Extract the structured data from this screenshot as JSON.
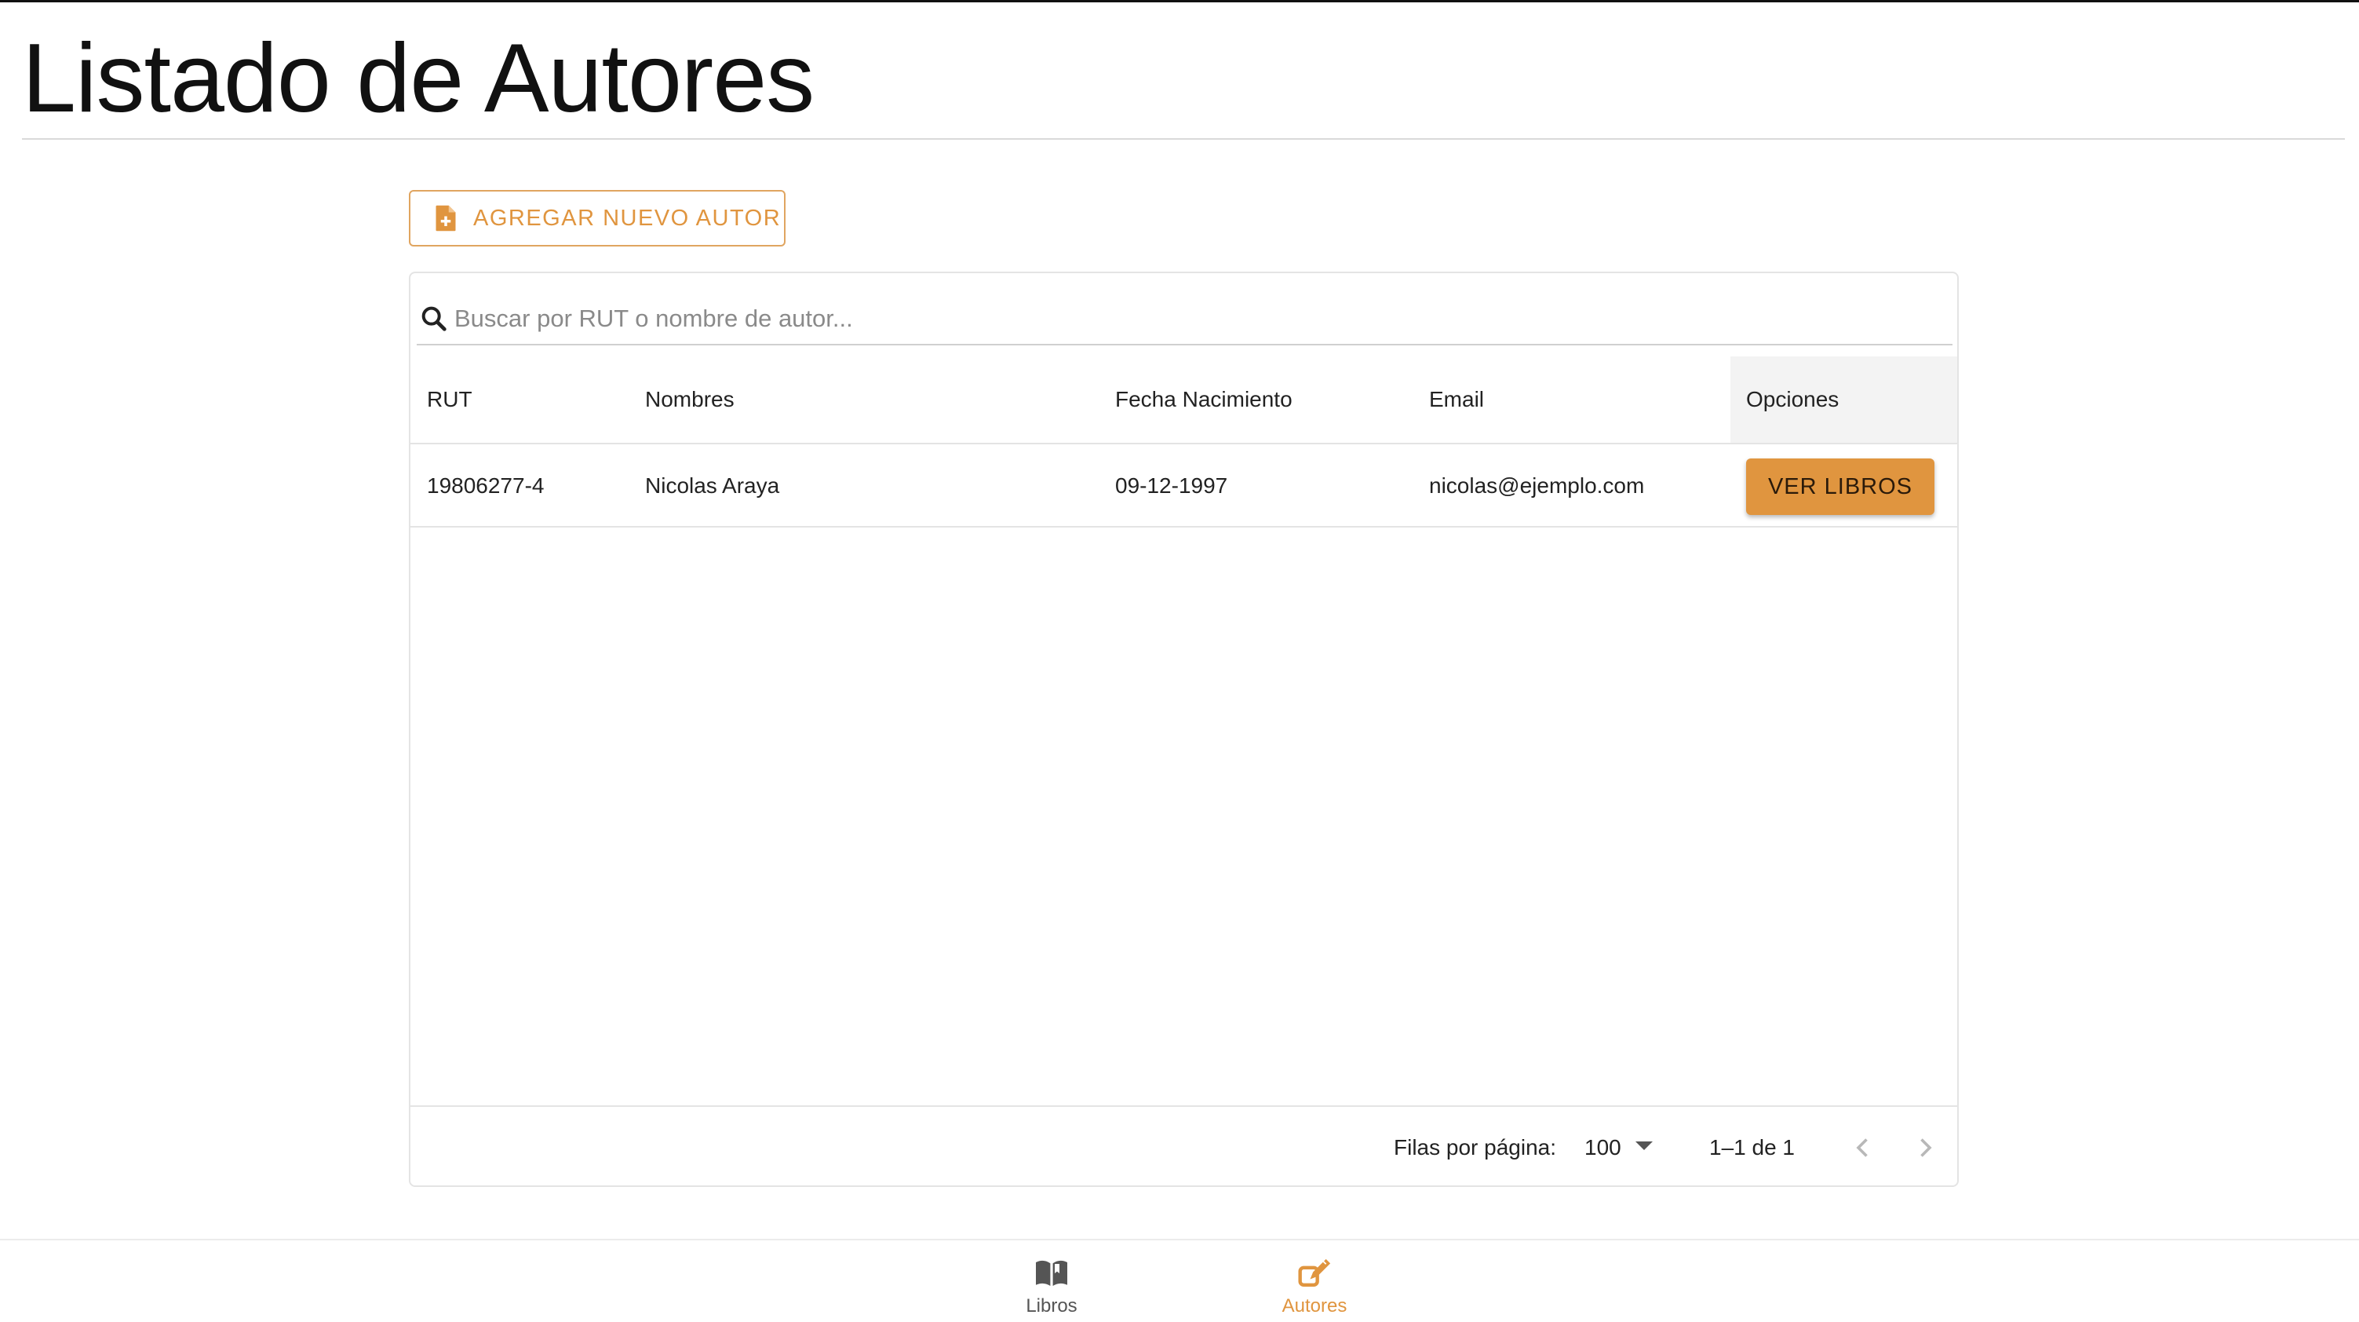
{
  "page": {
    "title": "Listado de Autores"
  },
  "toolbar": {
    "add_label": "AGREGAR NUEVO AUTOR"
  },
  "search": {
    "placeholder": "Buscar por RUT o nombre de autor...",
    "value": ""
  },
  "table": {
    "columns": [
      "RUT",
      "Nombres",
      "Fecha Nacimiento",
      "Email",
      "Opciones"
    ],
    "rows": [
      {
        "rut": "19806277-4",
        "nombres": "Nicolas Araya",
        "fecha": "09-12-1997",
        "email": "nicolas@ejemplo.com",
        "action": "VER LIBROS"
      }
    ]
  },
  "pagination": {
    "rows_label": "Filas por página:",
    "rows_per_page": "100",
    "range": "1–1 de 1"
  },
  "bottom_nav": {
    "items": [
      {
        "label": "Libros",
        "icon": "book-icon",
        "active": false
      },
      {
        "label": "Autores",
        "icon": "edit-pen-icon",
        "active": true
      }
    ]
  },
  "colors": {
    "accent": "#e0953f",
    "inactive": "#555555"
  }
}
